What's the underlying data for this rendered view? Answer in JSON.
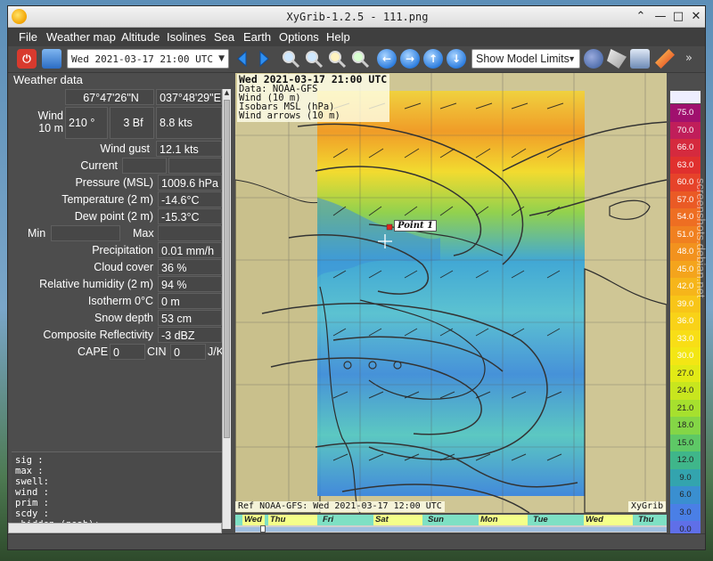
{
  "window": {
    "title": "XyGrib-1.2.5 - 111.png",
    "buttons": [
      "⌃",
      "—",
      "□",
      "✕"
    ]
  },
  "menu": [
    "File",
    "Weather map",
    "Altitude",
    "Isolines",
    "Sea",
    "Earth",
    "Options",
    "Help"
  ],
  "toolbar": {
    "date_select": "Wed 2021-03-17 21:00 UTC",
    "model_limits": "Show Model Limits",
    "more": "»"
  },
  "panel": {
    "title": "Weather data",
    "lat": "67°47'26\"N",
    "lon": "037°48'29\"E",
    "wind_label": "Wind\n10 m",
    "wind_dir": "210 °",
    "wind_bf": "3 Bf",
    "wind_speed": "8.8  kts",
    "gust_label": "Wind gust",
    "gust_value": "12.1  kts",
    "current_label": "Current",
    "pressure_label": "Pressure (MSL)",
    "pressure_value": "1009.6 hPa",
    "temp_label": "Temperature (2 m)",
    "temp_value": "-14.6°C",
    "dew_label": "Dew point (2 m)",
    "dew_value": "-15.3°C",
    "min_label": "Min",
    "max_label": "Max",
    "precip_label": "Precipitation",
    "precip_value": "0.01 mm/h",
    "cloud_label": "Cloud cover",
    "cloud_value": "36 %",
    "rh_label": "Relative humidity (2 m)",
    "rh_value": "94 %",
    "iso_label": "Isotherm 0°C",
    "iso_value": "0 m",
    "snow_label": "Snow depth",
    "snow_value": "53 cm",
    "refl_label": "Composite Reflectivity",
    "refl_value": "-3 dBZ",
    "cape_label": "CAPE",
    "cape_value": "0",
    "cin_label": "CIN",
    "cin_value": "0",
    "jk_label": "J/K",
    "info_lines": [
      "sig  :",
      "max  :",
      "swell:",
      "wind :",
      "prim :",
      "scdy :",
      "_hidden (noab):"
    ]
  },
  "map": {
    "info_lines": [
      "Wed 2021-03-17 21:00 UTC",
      "Data: NOAA-GFS",
      "Wind (10 m)",
      "Isobars MSL (hPa)",
      "Wind arrows (10 m)"
    ],
    "point_label": "Point 1",
    "ref_label": "Ref NOAA-GFS: Wed 2021-03-17 12:00 UTC",
    "app_label": "XyGrib"
  },
  "timeline": {
    "days": [
      "Wed",
      "Thu",
      "Fri",
      "Sat",
      "Sun",
      "Mon",
      "Tue",
      "Wed",
      "Thu"
    ]
  },
  "colorbar": {
    "values": [
      "75.0",
      "70.0",
      "66.0",
      "63.0",
      "60.0",
      "57.0",
      "54.0",
      "51.0",
      "48.0",
      "45.0",
      "42.0",
      "39.0",
      "36.0",
      "33.0",
      "30.0",
      "27.0",
      "24.0",
      "21.0",
      "18.0",
      "15.0",
      "12.0",
      "9.0",
      "6.0",
      "3.0",
      "0.0"
    ],
    "colors": [
      "#a0106e",
      "#c01e5a",
      "#d52a3e",
      "#e0302e",
      "#e6432a",
      "#ea5a25",
      "#ee6e22",
      "#f08020",
      "#f2921e",
      "#f4a41c",
      "#f6b51a",
      "#f8c518",
      "#f9d218",
      "#f8de16",
      "#f3e614",
      "#e2ea16",
      "#c8e61e",
      "#a6e02e",
      "#84d646",
      "#5ec866",
      "#3fb68a",
      "#33a4ae",
      "#3a8fd0",
      "#4a7fe6",
      "#5f6fe8"
    ]
  },
  "watermark": "screenshots.debian.net"
}
